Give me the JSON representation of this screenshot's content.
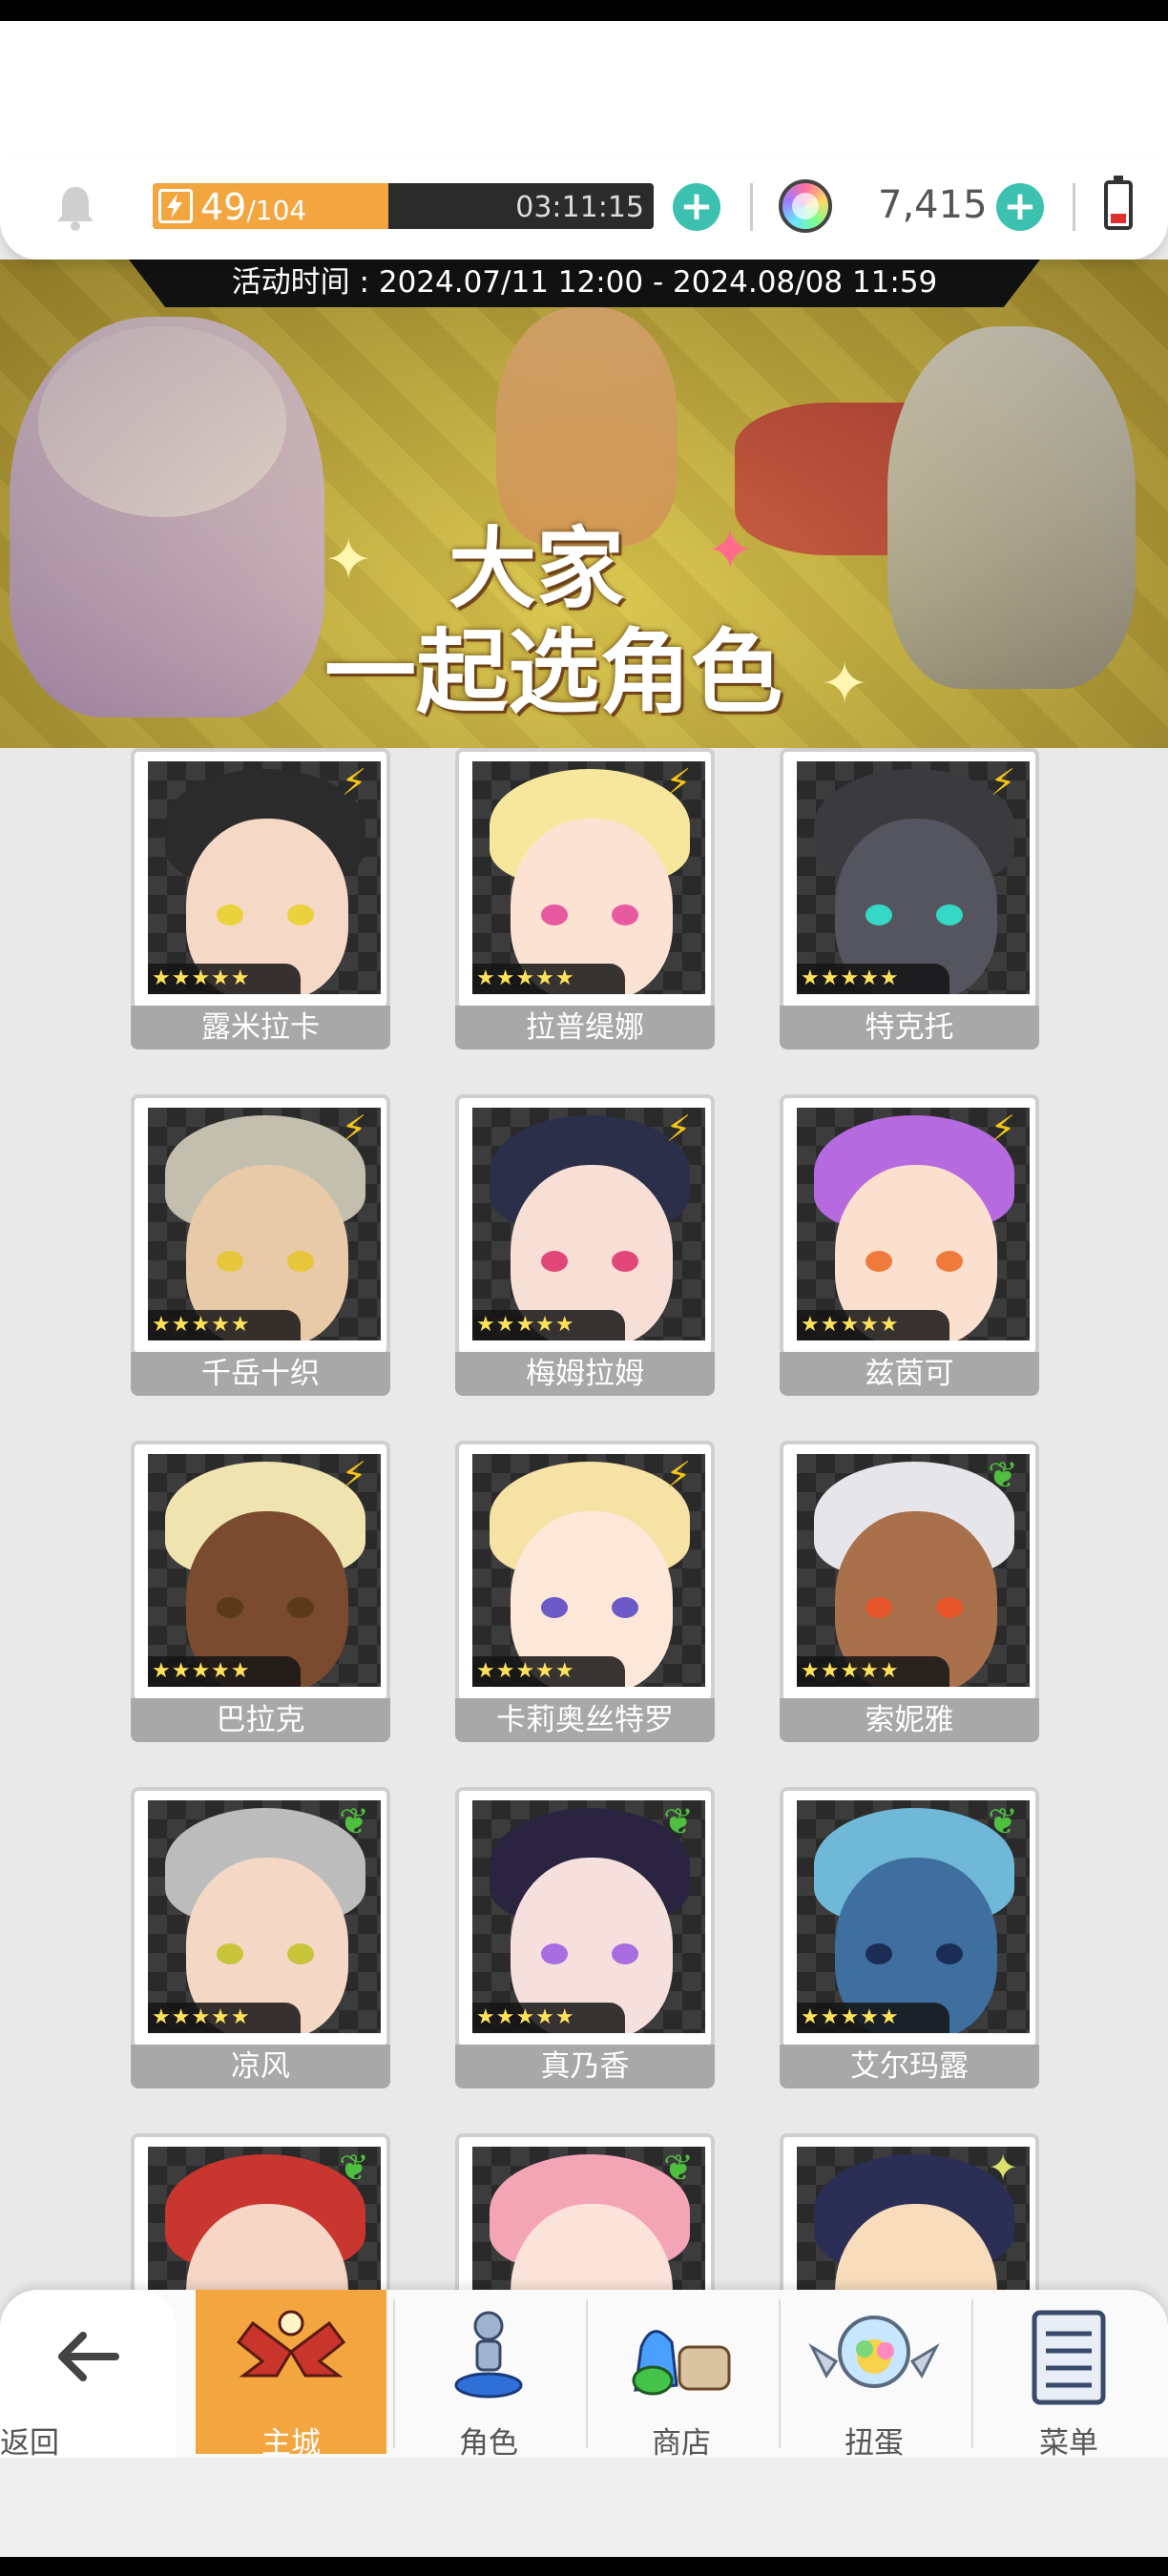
{
  "status_bar": {
    "stamina_current": "49",
    "stamina_max": "/104",
    "stamina_fraction": 0.47,
    "stamina_timer": "03:11:15",
    "gem_count": "7,415"
  },
  "banner": {
    "event_time": "活动时间 : 2024.07/11 12:00 - 2024.08/08 11:59",
    "title_line1": "大家",
    "title_line2": "一起选角色"
  },
  "characters": [
    {
      "name": "露米拉卡",
      "stars": "★★★★★",
      "element": "lightning",
      "hair": "#2b2b2b",
      "skin": "#f6d8c6",
      "eye": "#e9d23c"
    },
    {
      "name": "拉普缇娜",
      "stars": "★★★★★",
      "element": "lightning",
      "hair": "#f7e79c",
      "skin": "#fbe2d3",
      "eye": "#e85aa0"
    },
    {
      "name": "特克托",
      "stars": "★★★★★",
      "element": "lightning",
      "hair": "#3a3a3f",
      "skin": "#555560",
      "eye": "#35d8c4"
    },
    {
      "name": "千岳十织",
      "stars": "★★★★★",
      "element": "lightning",
      "hair": "#c2bfae",
      "skin": "#e8c9a8",
      "eye": "#e6c63a"
    },
    {
      "name": "梅姆拉姆",
      "stars": "★★★★★",
      "element": "lightning",
      "hair": "#2c2f4a",
      "skin": "#f8dfd6",
      "eye": "#e2477a"
    },
    {
      "name": "兹茵可",
      "stars": "★★★★★",
      "element": "lightning",
      "hair": "#b66adf",
      "skin": "#fbdfcf",
      "eye": "#f07a3c"
    },
    {
      "name": "巴拉克",
      "stars": "★★★★★",
      "element": "lightning",
      "hair": "#efe3b0",
      "skin": "#7a4b2f",
      "eye": "#5a3a1a"
    },
    {
      "name": "卡莉奥丝特罗",
      "stars": "★★★★★",
      "element": "lightning",
      "hair": "#f6e2a4",
      "skin": "#fde7d8",
      "eye": "#6b5ac8"
    },
    {
      "name": "索妮雅",
      "stars": "★★★★★",
      "element": "wind",
      "hair": "#e6e6ea",
      "skin": "#a9704c",
      "eye": "#e8562c"
    },
    {
      "name": "凉风",
      "stars": "★★★★★",
      "element": "wind",
      "hair": "#bcbcbc",
      "skin": "#f4d7c4",
      "eye": "#c8c43a"
    },
    {
      "name": "真乃香",
      "stars": "★★★★★",
      "element": "wind",
      "hair": "#2a2440",
      "skin": "#f6e0dd",
      "eye": "#a86de0"
    },
    {
      "name": "艾尔玛露",
      "stars": "★★★★★",
      "element": "wind",
      "hair": "#6fb8d8",
      "skin": "#3f6f9f",
      "eye": "#1c2d55"
    },
    {
      "name": "",
      "stars": "",
      "element": "wind",
      "hair": "#c8362f",
      "skin": "#f6d6c6",
      "eye": "#f1b427"
    },
    {
      "name": "",
      "stars": "",
      "element": "wind",
      "hair": "#f4a5b5",
      "skin": "#fbe3d9",
      "eye": "#8a5a3a"
    },
    {
      "name": "",
      "stars": "",
      "element": "light",
      "hair": "#2c2f55",
      "skin": "#f8dcbc",
      "eye": "#7a5ac8"
    }
  ],
  "nav": {
    "back": "返回",
    "main_city": "主城",
    "characters": "角色",
    "shop": "商店",
    "gacha": "扭蛋",
    "menu": "菜单"
  },
  "colors": {
    "accent_orange": "#f3a640",
    "plus_teal": "#3cc1b1",
    "lightning": "#f5c518",
    "wind": "#4fbf3f",
    "light": "#dbe06c"
  }
}
